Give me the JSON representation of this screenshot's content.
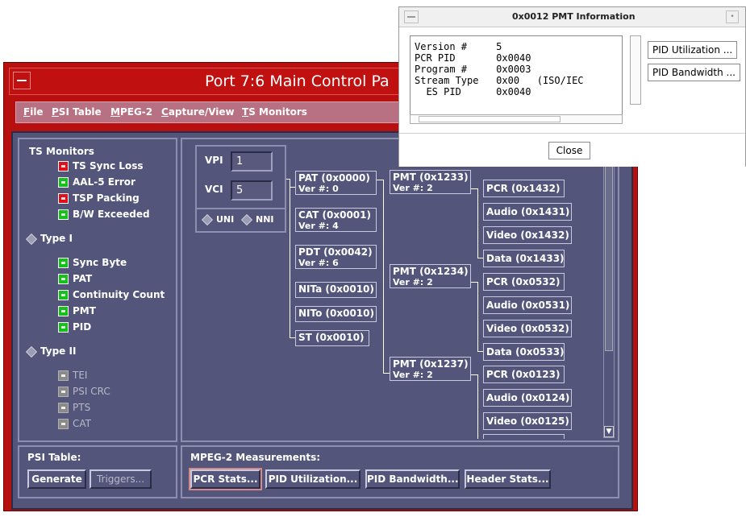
{
  "main_window": {
    "title": "Port 7:6 Main Control Pa",
    "menu": [
      "File",
      "PSI Table",
      "MPEG-2",
      "Capture/View",
      "TS Monitors"
    ]
  },
  "ts_monitors": {
    "title": "TS Monitors",
    "top_items": [
      {
        "label": "TS Sync Loss",
        "state": "red"
      },
      {
        "label": "AAL-5 Error",
        "state": "green"
      },
      {
        "label": "TSP Packing",
        "state": "red"
      },
      {
        "label": "B/W Exceeded",
        "state": "green"
      }
    ],
    "type1": {
      "label": "Type I",
      "items": [
        {
          "label": "Sync Byte",
          "state": "green"
        },
        {
          "label": "PAT",
          "state": "green"
        },
        {
          "label": "Continuity Count",
          "state": "green"
        },
        {
          "label": "PMT",
          "state": "green"
        },
        {
          "label": "PID",
          "state": "green"
        }
      ]
    },
    "type2": {
      "label": "Type II",
      "items": [
        {
          "label": "TEI",
          "state": "disabled"
        },
        {
          "label": "PSI CRC",
          "state": "disabled"
        },
        {
          "label": "PTS",
          "state": "disabled"
        },
        {
          "label": "CAT",
          "state": "disabled"
        }
      ]
    }
  },
  "connection": {
    "vpi_label": "VPI",
    "vpi_value": "1",
    "vci_label": "VCI",
    "vci_value": "5",
    "uni_label": "UNI",
    "nni_label": "NNI"
  },
  "tree": {
    "tables": [
      {
        "name": "PAT (0x0000)",
        "ver": "Ver #: 0"
      },
      {
        "name": "CAT (0x0001)",
        "ver": "Ver #: 4"
      },
      {
        "name": "PDT (0x0042)",
        "ver": "Ver #: 6"
      },
      {
        "name": "NITa (0x0010)",
        "ver": ""
      },
      {
        "name": "NITo (0x0010)",
        "ver": ""
      },
      {
        "name": "ST (0x0010)",
        "ver": ""
      }
    ],
    "pmts": [
      {
        "name": "PMT (0x1233)",
        "ver": "Ver #: 2",
        "streams": [
          "PCR (0x1432)",
          "Audio (0x1431)",
          "Video (0x1432)",
          "Data (0x1433)"
        ]
      },
      {
        "name": "PMT (0x1234)",
        "ver": "Ver #: 2",
        "streams": [
          "PCR (0x0532)",
          "Audio (0x0531)",
          "Video (0x0532)",
          "Data (0x0533)"
        ]
      },
      {
        "name": "PMT (0x1237)",
        "ver": "Ver #: 2",
        "streams": [
          "PCR (0x0123)",
          "Audio (0x0124)",
          "Video (0x0125)"
        ]
      }
    ]
  },
  "psi_table": {
    "title": "PSI Table:",
    "generate": "Generate",
    "triggers": "Triggers..."
  },
  "mpeg2": {
    "title": "MPEG-2 Measurements:",
    "buttons": [
      "PCR Stats...",
      "PID Utilization...",
      "PID Bandwidth...",
      "Header Stats..."
    ]
  },
  "popup": {
    "title": "0x0012 PMT Information",
    "lines": [
      "Version #     5",
      "PCR PID       0x0040",
      "Program #     0x0003",
      "Stream Type   0x00   (ISO/IEC",
      "  ES PID      0x0040"
    ],
    "util_button": "PID Utilization ...",
    "bw_button": "PID Bandwidth ...",
    "close": "Close"
  },
  "colors": {
    "frame": "#b80f0f",
    "menubar": "#b87083",
    "panel": "#53557a",
    "led_red": "#e0101a",
    "led_green": "#18c01c"
  }
}
